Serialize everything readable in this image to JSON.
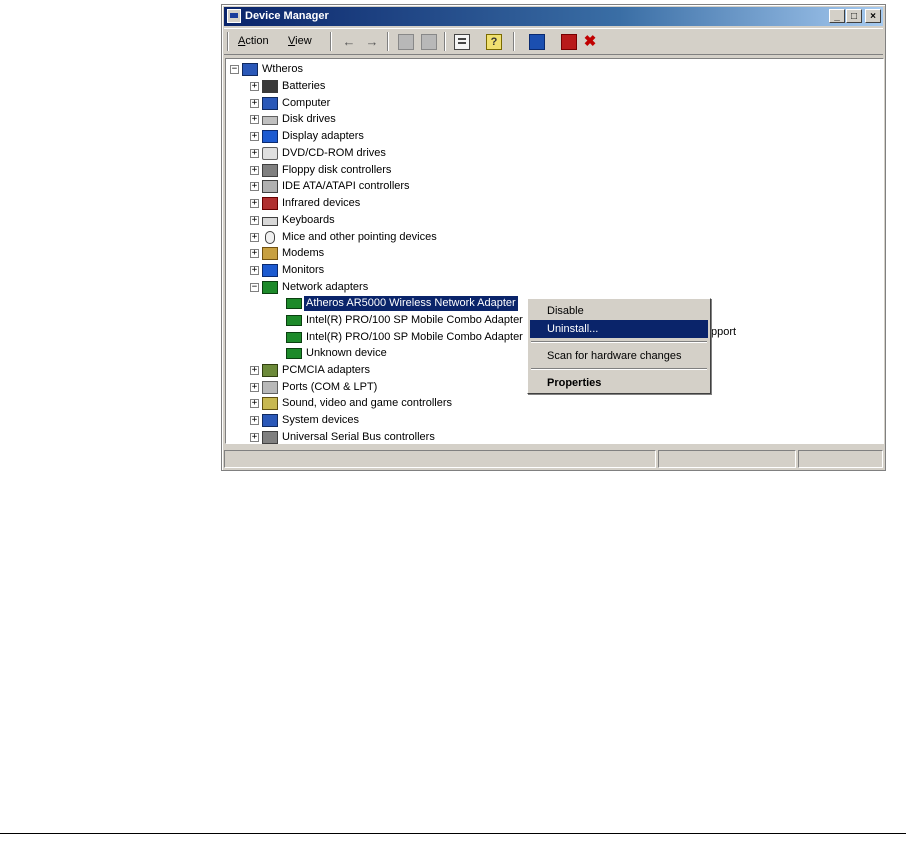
{
  "window": {
    "title": "Device Manager",
    "controls": {
      "minimize": "_",
      "maximize": "□",
      "close": "×"
    }
  },
  "menu": [
    {
      "label": "Action",
      "accel": "A",
      "rest": "ction"
    },
    {
      "label": "View",
      "accel": "V",
      "rest": "iew"
    }
  ],
  "toolbar": {
    "back": "←",
    "forward": "→",
    "help": "?",
    "remove": "✖",
    "icons": [
      "back-icon",
      "forward-icon",
      "tree-view-icon",
      "list-view-icon",
      "properties-icon",
      "help-icon",
      "scan-hardware-icon",
      "disable-icon",
      "uninstall-icon"
    ]
  },
  "tree": {
    "root": "Wtheros",
    "expanded_sign": "−",
    "collapsed_sign": "+",
    "categories": [
      {
        "label": "Batteries",
        "icon": "battery-icon"
      },
      {
        "label": "Computer",
        "icon": "computer-icon"
      },
      {
        "label": "Disk drives",
        "icon": "disk-icon"
      },
      {
        "label": "Display adapters",
        "icon": "display-icon"
      },
      {
        "label": "DVD/CD-ROM drives",
        "icon": "cdrom-icon"
      },
      {
        "label": "Floppy disk controllers",
        "icon": "floppy-icon"
      },
      {
        "label": "IDE ATA/ATAPI controllers",
        "icon": "ide-icon"
      },
      {
        "label": "Infrared devices",
        "icon": "infrared-icon"
      },
      {
        "label": "Keyboards",
        "icon": "keyboard-icon"
      },
      {
        "label": "Mice and other pointing devices",
        "icon": "mouse-icon"
      },
      {
        "label": "Modems",
        "icon": "modem-icon"
      },
      {
        "label": "Monitors",
        "icon": "monitor-icon"
      },
      {
        "label": "Network adapters",
        "icon": "network-icon",
        "expanded": true
      }
    ],
    "network_children": [
      {
        "label": "Atheros AR5000 Wireless Network Adapter",
        "selected": true
      },
      {
        "label": "Intel(R) PRO/100 SP Mobile Combo Adapter"
      },
      {
        "label": "Intel(R) PRO/100 SP Mobile Combo Adapter"
      },
      {
        "label": "Unknown device"
      }
    ],
    "categories_after": [
      {
        "label": "PCMCIA adapters",
        "icon": "pcmcia-icon"
      },
      {
        "label": "Ports (COM & LPT)",
        "icon": "ports-icon"
      },
      {
        "label": "Sound, video and game controllers",
        "icon": "sound-icon"
      },
      {
        "label": "System devices",
        "icon": "system-icon"
      },
      {
        "label": "Universal Serial Bus controllers",
        "icon": "usb-icon"
      }
    ],
    "partial_text_behind_menu": "pport"
  },
  "context_menu": {
    "items": [
      "Disable",
      "Uninstall...",
      "Scan for hardware changes",
      "Properties"
    ],
    "highlighted": "Uninstall...",
    "default": "Properties"
  },
  "status_bar": {
    "panels": [
      "",
      "",
      ""
    ]
  }
}
